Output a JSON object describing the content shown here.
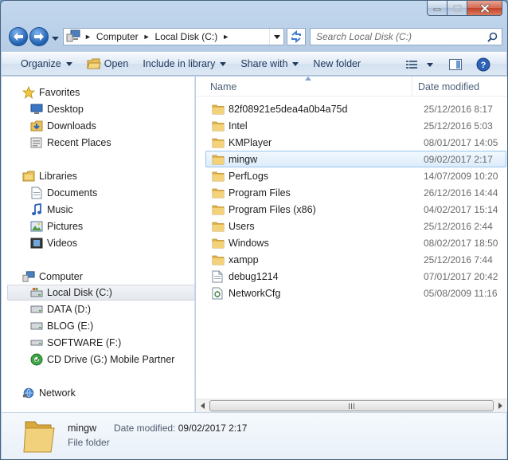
{
  "window": {
    "caption_buttons": {
      "minimize": "minimize-icon",
      "maximize": "maximize-icon",
      "close": "close-icon"
    }
  },
  "address": {
    "crumbs": [
      "Computer",
      "Local Disk (C:)"
    ],
    "search_placeholder": "Search Local Disk (C:)"
  },
  "toolbar": {
    "organize": "Organize",
    "open": "Open",
    "include_in_library": "Include in library",
    "share_with": "Share with",
    "new_folder": "New folder"
  },
  "nav": {
    "favorites": {
      "label": "Favorites",
      "items": [
        "Desktop",
        "Downloads",
        "Recent Places"
      ]
    },
    "libraries": {
      "label": "Libraries",
      "items": [
        "Documents",
        "Music",
        "Pictures",
        "Videos"
      ]
    },
    "computer": {
      "label": "Computer",
      "items": [
        "Local Disk (C:)",
        "DATA (D:)",
        "BLOG (E:)",
        "SOFTWARE (F:)",
        "CD Drive (G:) Mobile Partner"
      ]
    },
    "network": {
      "label": "Network"
    }
  },
  "columns": {
    "name": "Name",
    "date": "Date modified"
  },
  "files": [
    {
      "name": "82f08921e5dea4a0b4a75d",
      "date": "25/12/2016 8:17",
      "icon": "folder-icon"
    },
    {
      "name": "Intel",
      "date": "25/12/2016 5:03",
      "icon": "folder-icon"
    },
    {
      "name": "KMPlayer",
      "date": "08/01/2017 14:05",
      "icon": "folder-icon"
    },
    {
      "name": "mingw",
      "date": "09/02/2017 2:17",
      "icon": "folder-icon"
    },
    {
      "name": "PerfLogs",
      "date": "14/07/2009 10:20",
      "icon": "folder-icon"
    },
    {
      "name": "Program Files",
      "date": "26/12/2016 14:44",
      "icon": "folder-icon"
    },
    {
      "name": "Program Files (x86)",
      "date": "04/02/2017 15:14",
      "icon": "folder-icon"
    },
    {
      "name": "Users",
      "date": "25/12/2016 2:44",
      "icon": "folder-icon"
    },
    {
      "name": "Windows",
      "date": "08/02/2017 18:50",
      "icon": "folder-icon"
    },
    {
      "name": "xampp",
      "date": "25/12/2016 7:44",
      "icon": "folder-icon"
    },
    {
      "name": "debug1214",
      "date": "07/01/2017 20:42",
      "icon": "text-file-icon"
    },
    {
      "name": "NetworkCfg",
      "date": "05/08/2009 11:16",
      "icon": "config-file-icon"
    }
  ],
  "details": {
    "name": "mingw",
    "type": "File folder",
    "modified_label": "Date modified:",
    "modified_value": "09/02/2017 2:17"
  }
}
